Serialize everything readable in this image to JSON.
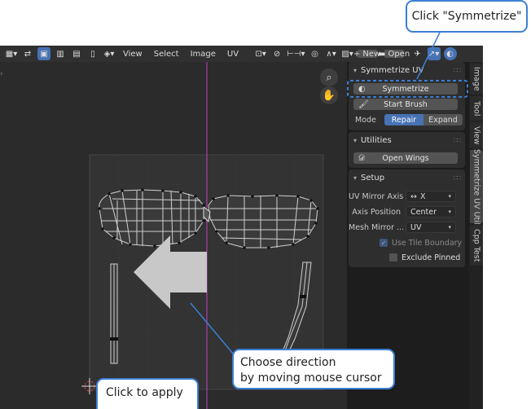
{
  "header": {
    "menus": [
      "View",
      "Select",
      "Image",
      "UV"
    ],
    "new_label": "New",
    "open_label": "Open"
  },
  "panel": {
    "symmetrize_section": {
      "title": "Symmetrize UV",
      "symmetrize_button": "Symmetrize",
      "start_brush_button": "Start Brush",
      "mode_label": "Mode",
      "mode_options": [
        "Repair",
        "Expand"
      ],
      "mode_selected": "Repair"
    },
    "utilities_section": {
      "title": "Utilities",
      "open_wings_button": "Open Wings"
    },
    "setup_section": {
      "title": "Setup",
      "uv_mirror_axis_label": "UV Mirror Axis",
      "uv_mirror_axis_value": "X",
      "axis_position_label": "Axis Position",
      "axis_position_value": "Center",
      "mesh_mirror_label": "Mesh Mirror ...",
      "mesh_mirror_value": "UV",
      "use_tile_boundary_label": "Use Tile Boundary",
      "use_tile_boundary_checked": true,
      "exclude_pinned_label": "Exclude Pinned",
      "exclude_pinned_checked": false
    }
  },
  "tabs": [
    "Image",
    "Tool",
    "View",
    "Symmetrize UV Util",
    "Cpp Test"
  ],
  "selected_tab": "Symmetrize UV Util",
  "callouts": {
    "click_symmetrize": "Click \"Symmetrize\"",
    "choose_direction_line1": "Choose direction",
    "choose_direction_line2": "by moving mouse cursor",
    "click_to_apply": "Click to apply"
  },
  "colors": {
    "accent": "#4772b3",
    "callout_border": "#3b7fd4",
    "mirror_axis": "#c040c0"
  }
}
